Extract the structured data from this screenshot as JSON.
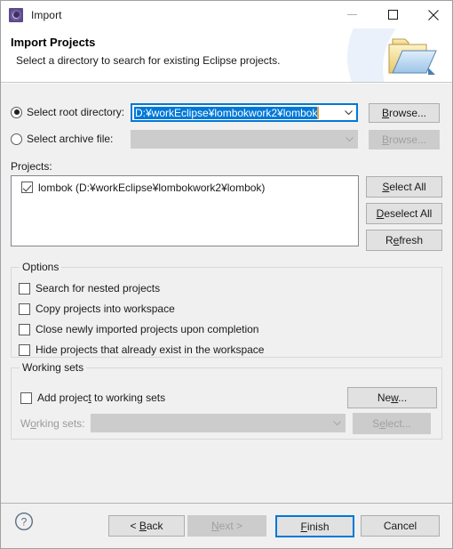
{
  "window": {
    "title": "Import",
    "app_icon": "eclipse-import-icon",
    "controls": {
      "minimize": "minimize-icon",
      "maximize": "maximize-icon",
      "close": "close-icon"
    }
  },
  "header": {
    "title": "Import Projects",
    "subtitle": "Select a directory to search for existing Eclipse projects.",
    "banner_icon": "folder-import-icon"
  },
  "source": {
    "root_directory": {
      "label": "Select root directory:",
      "selected": true,
      "value": "D:¥workEclipse¥lombokwork2¥lombok",
      "placeholder": "",
      "browse_label": "Browse..."
    },
    "archive_file": {
      "label": "Select archive file:",
      "selected": false,
      "value": "",
      "placeholder": "",
      "browse_label": "Browse..."
    }
  },
  "projects": {
    "label": "Projects:",
    "items": [
      {
        "checked": true,
        "label": "lombok (D:¥workEclipse¥lombokwork2¥lombok)"
      }
    ],
    "buttons": {
      "select_all": "Select All",
      "deselect_all": "Deselect All",
      "refresh": "Refresh"
    }
  },
  "options": {
    "title": "Options",
    "items": [
      {
        "label": "Search for nested projects",
        "checked": false
      },
      {
        "label": "Copy projects into workspace",
        "checked": false
      },
      {
        "label": "Close newly imported projects upon completion",
        "checked": false
      },
      {
        "label": "Hide projects that already exist in the workspace",
        "checked": false
      }
    ]
  },
  "working_sets": {
    "title": "Working sets",
    "add_checkbox": {
      "label": "Add project to working sets",
      "checked": false
    },
    "combo_label": "Working sets:",
    "combo_value": "",
    "new_label": "New...",
    "select_label": "Select..."
  },
  "footer": {
    "help_icon": "help-icon",
    "back": "< Back",
    "next": "Next >",
    "finish": "Finish",
    "cancel": "Cancel"
  },
  "colors": {
    "accent": "#0078d7",
    "selection": "#0078d7",
    "caret": "#e8a33d",
    "dialog_bg": "#f0f0f0"
  }
}
